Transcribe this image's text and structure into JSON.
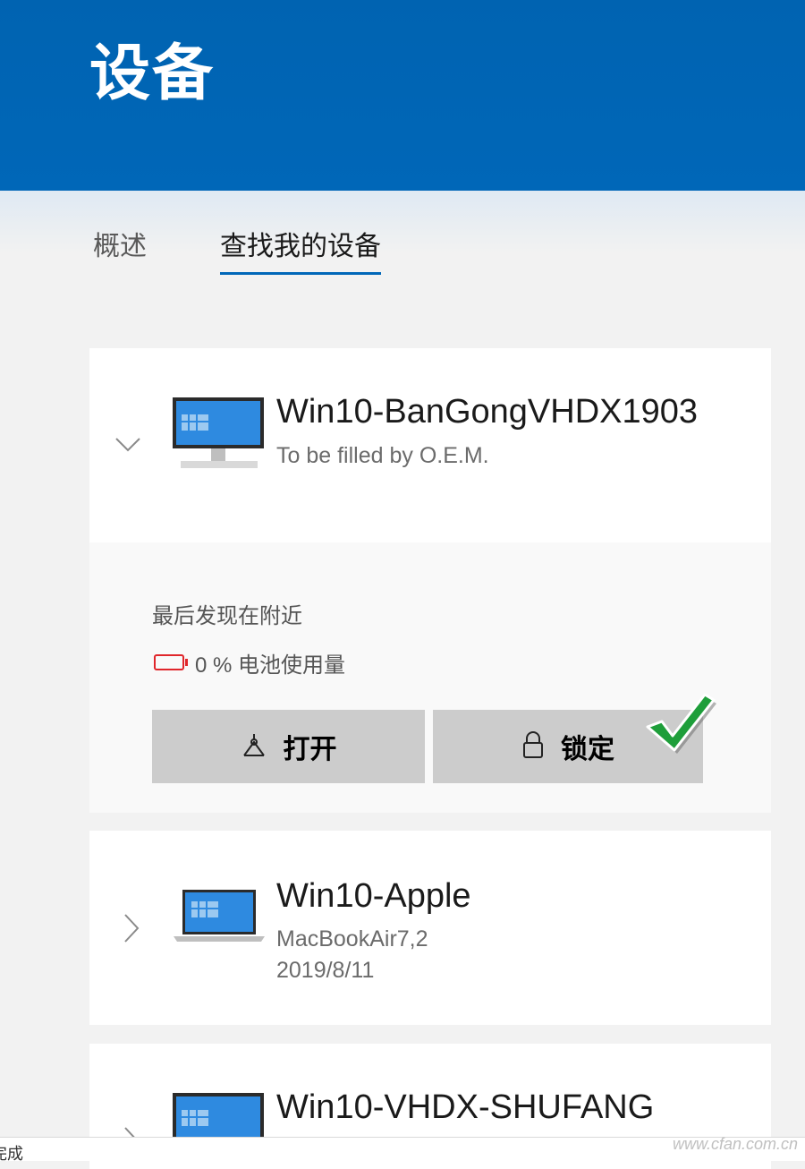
{
  "header": {
    "title": "设备"
  },
  "tabs": [
    {
      "label": "概述",
      "active": false
    },
    {
      "label": "查找我的设备",
      "active": true
    }
  ],
  "devices": [
    {
      "name": "Win10-BanGongVHDX1903",
      "model": "To be filled by O.E.M.",
      "expanded": true,
      "type": "desktop",
      "details": {
        "last_seen": "最后发现在附近",
        "battery": "0 % 电池使用量"
      },
      "actions": {
        "open_label": "打开",
        "lock_label": "锁定"
      }
    },
    {
      "name": "Win10-Apple",
      "model": "MacBookAir7,2",
      "date": "2019/8/11",
      "expanded": false,
      "type": "laptop"
    },
    {
      "name": "Win10-VHDX-SHUFANG",
      "expanded": false,
      "type": "desktop"
    }
  ],
  "status_bar": {
    "text": "完成"
  },
  "watermark": "www.cfan.com.cn",
  "colors": {
    "accent": "#0067b8",
    "battery_low": "#e0262b",
    "button_bg": "#cccccc",
    "checkmark": "#1e9e3a"
  }
}
